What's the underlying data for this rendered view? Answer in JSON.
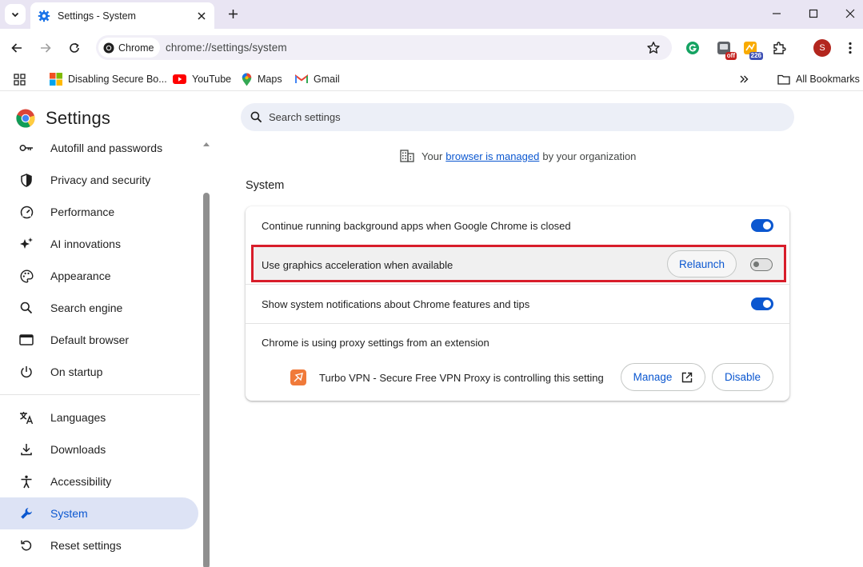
{
  "browser": {
    "tab_title": "Settings - System",
    "omnibox_chip": "Chrome",
    "url": "chrome://settings/system",
    "extensions": [
      {
        "name": "grammarly-icon",
        "badge": ""
      },
      {
        "name": "adblock-extension-icon",
        "badge": "off"
      },
      {
        "name": "counter-extension-icon",
        "badge": "226"
      }
    ],
    "profile_initial": "S",
    "accent": "#0b57d0"
  },
  "bookmarks": {
    "items": [
      {
        "label": "Disabling Secure Bo..."
      },
      {
        "label": "YouTube"
      },
      {
        "label": "Maps"
      },
      {
        "label": "Gmail"
      }
    ],
    "all_bookmarks": "All Bookmarks"
  },
  "sidebar": {
    "title": "Settings",
    "items": [
      {
        "label": "Autofill and passwords",
        "icon": "key-icon"
      },
      {
        "label": "Privacy and security",
        "icon": "shield-icon"
      },
      {
        "label": "Performance",
        "icon": "speedometer-icon"
      },
      {
        "label": "AI innovations",
        "icon": "sparkle-icon"
      },
      {
        "label": "Appearance",
        "icon": "palette-icon"
      },
      {
        "label": "Search engine",
        "icon": "search-icon"
      },
      {
        "label": "Default browser",
        "icon": "browser-window-icon"
      },
      {
        "label": "On startup",
        "icon": "power-icon"
      },
      {
        "label": "Languages",
        "icon": "translate-icon"
      },
      {
        "label": "Downloads",
        "icon": "download-icon"
      },
      {
        "label": "Accessibility",
        "icon": "accessibility-icon"
      },
      {
        "label": "System",
        "icon": "wrench-icon",
        "active": true
      },
      {
        "label": "Reset settings",
        "icon": "reset-icon"
      }
    ]
  },
  "main": {
    "search_placeholder": "Search settings",
    "managed": {
      "prefix": "Your",
      "link": "browser is managed",
      "suffix": "by your organization"
    },
    "section_title": "System",
    "rows": {
      "background_apps": {
        "label": "Continue running background apps when Google Chrome is closed",
        "enabled": true
      },
      "graphics_accel": {
        "label": "Use graphics acceleration when available",
        "button": "Relaunch",
        "enabled": false
      },
      "notifications": {
        "label": "Show system notifications about Chrome features and tips",
        "enabled": true
      },
      "proxy": {
        "label": "Chrome is using proxy settings from an extension",
        "extension_text": "Turbo VPN - Secure Free VPN Proxy is controlling this setting",
        "manage_button": "Manage",
        "disable_button": "Disable"
      }
    }
  }
}
